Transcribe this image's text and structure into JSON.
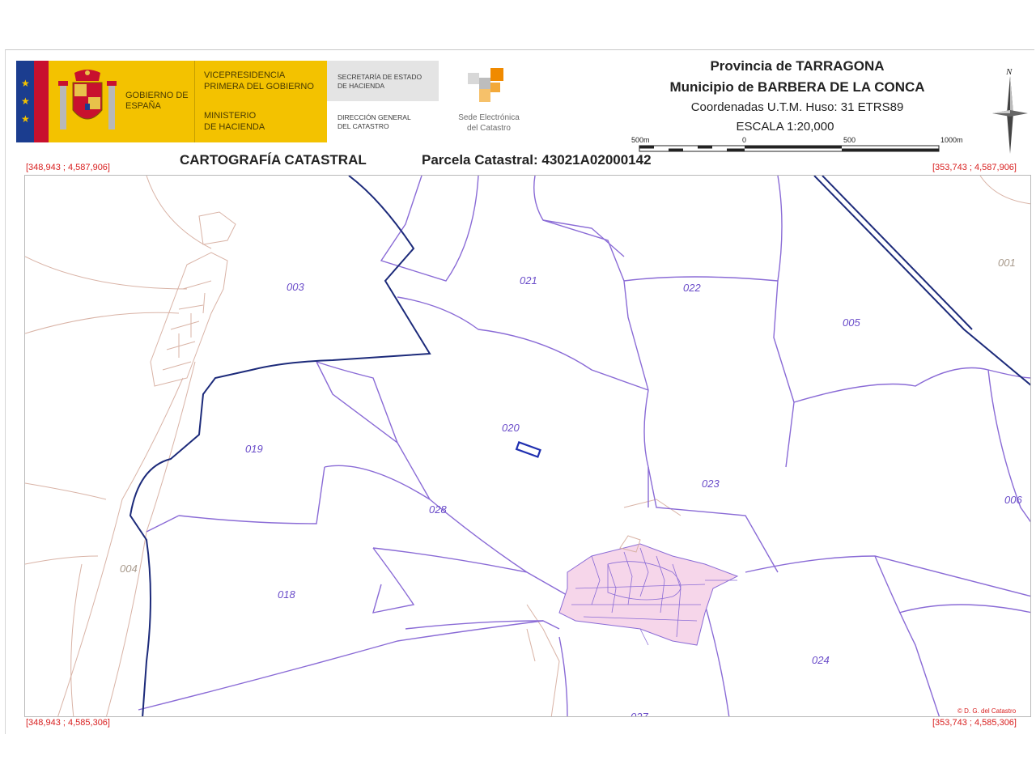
{
  "header": {
    "gov_name": "GOBIERNO DE ESPAÑA",
    "vice_1": "VICEPRESIDENCIA",
    "vice_2": "PRIMERA DEL GOBIERNO",
    "ministry_1": "MINISTERIO",
    "ministry_2": "DE HACIENDA",
    "secretaria_1": "SECRETARÍA DE ESTADO",
    "secretaria_2": "DE HACIENDA",
    "direccion_1": "DIRECCIÓN GENERAL",
    "direccion_2": "DEL CATASTRO",
    "sede_1": "Sede Electrónica",
    "sede_2": "del Catastro",
    "province": "Provincia de TARRAGONA",
    "municipality": "Municipio de BARBERA DE LA CONCA",
    "coordinates_system": "Coordenadas U.T.M. Huso: 31 ETRS89",
    "scale": "ESCALA 1:20,000",
    "scale_ticks": [
      "500m",
      "0",
      "500",
      "1000m"
    ],
    "north_label": "N",
    "section_title": "CARTOGRAFÍA CATASTRAL",
    "parcel": "Parcela Catastral: 43021A02000142"
  },
  "corners": {
    "top_left": "[348,943 ; 4,587,906]",
    "top_right": "[353,743 ; 4,587,906]",
    "bottom_left": "[348,943 ; 4,585,306]",
    "bottom_right": "[353,743 ; 4,585,306]"
  },
  "map": {
    "credit": "© D. G. del Catastro",
    "parcel_labels": [
      "003",
      "021",
      "022",
      "001",
      "005",
      "020",
      "019",
      "023",
      "006",
      "028",
      "004",
      "018",
      "024",
      "027"
    ],
    "colors": {
      "municipal_boundary": "#1c2a7a",
      "parcel_lines": "#8a6bd6",
      "neighbor_lines": "#d9b3a6",
      "urban_fill": "#f6d6ea",
      "selected_parcel": "#1f2fb0",
      "label": "#6a4cc9"
    }
  }
}
